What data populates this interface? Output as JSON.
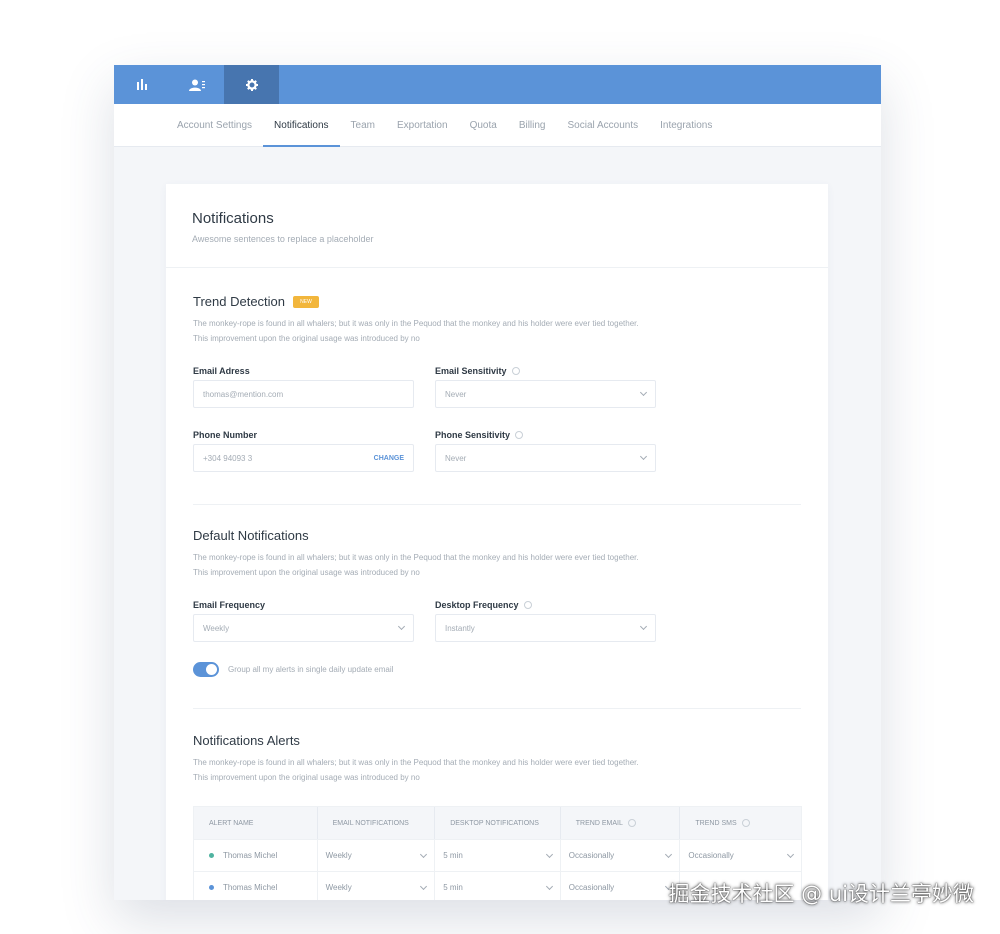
{
  "topbar": {
    "icons": [
      "bar-chart-icon",
      "users-icon",
      "gear-icon"
    ],
    "active": "gear-icon"
  },
  "tabs": [
    {
      "label": "Account Settings",
      "active": false
    },
    {
      "label": "Notifications",
      "active": true
    },
    {
      "label": "Team",
      "active": false
    },
    {
      "label": "Exportation",
      "active": false
    },
    {
      "label": "Quota",
      "active": false
    },
    {
      "label": "Billing",
      "active": false
    },
    {
      "label": "Social Accounts",
      "active": false
    },
    {
      "label": "Integrations",
      "active": false
    }
  ],
  "page": {
    "title": "Notifications",
    "subtitle": "Awesome sentences to replace a placeholder"
  },
  "trend": {
    "title": "Trend Detection",
    "badge": "NEW",
    "desc1": "The monkey-rope is found in all whalers; but it was only in the Pequod that the monkey and his holder were ever tied together.",
    "desc2": "This improvement upon the original usage was introduced by no",
    "email_label": "Email Adress",
    "email_value": "thomas@mention.com",
    "email_sens_label": "Email Sensitivity",
    "email_sens_value": "Never",
    "phone_label": "Phone Number",
    "phone_value": "+304 94093 3",
    "phone_change": "CHANGE",
    "phone_sens_label": "Phone Sensitivity",
    "phone_sens_value": "Never"
  },
  "defaults": {
    "title": "Default Notifications",
    "desc1": "The monkey-rope is found in all whalers; but it was only in the Pequod that the monkey and his holder were ever tied together.",
    "desc2": "This improvement upon the original usage was introduced by no",
    "email_freq_label": "Email Frequency",
    "email_freq_value": "Weekly",
    "desktop_freq_label": "Desktop Frequency",
    "desktop_freq_value": "Instantly",
    "toggle_label": "Group all my alerts in single daily update email",
    "toggle_on": true
  },
  "alerts": {
    "title": "Notifications Alerts",
    "desc1": "The monkey-rope is found in all whalers; but it was only in the Pequod that the monkey and his holder were ever tied together.",
    "desc2": "This improvement upon the original usage was introduced by no",
    "headers": [
      "ALERT NAME",
      "EMAIL NOTIFICATIONS",
      "DESKTOP NOTIFICATIONS",
      "TREND EMAIL",
      "TREND SMS"
    ],
    "rows": [
      {
        "name": "Thomas Michel",
        "dot": "#4fb3a0",
        "email": "Weekly",
        "desktop": "5 min",
        "trend_email": "Occasionally",
        "trend_sms": "Occasionally"
      },
      {
        "name": "Thomas Michel",
        "dot": "#5b93d8",
        "email": "Weekly",
        "desktop": "5 min",
        "trend_email": "Occasionally",
        "trend_sms": ""
      }
    ]
  },
  "watermark": "掘金技术社区 @ ui设计兰亭妙微"
}
